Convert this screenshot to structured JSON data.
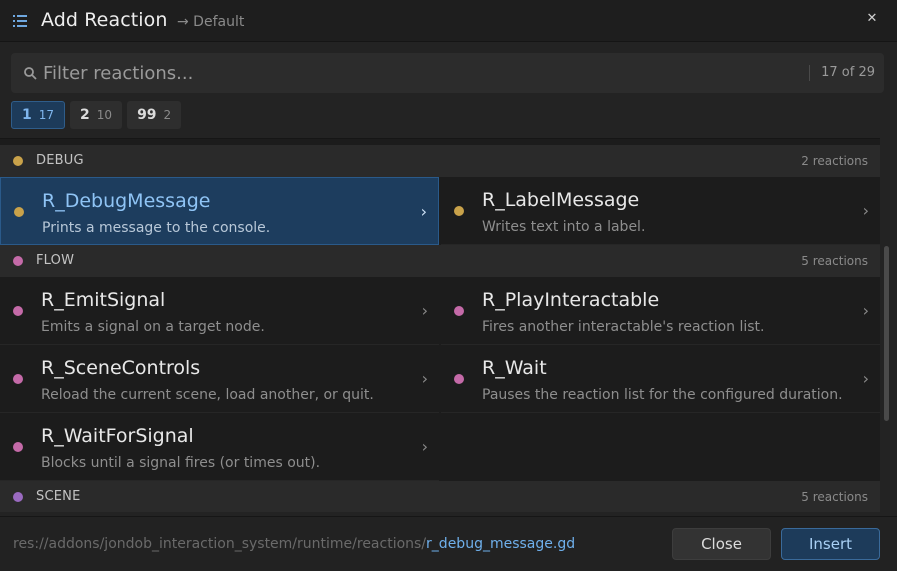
{
  "window": {
    "title": "Add Reaction",
    "subtitle": "→ Default",
    "close_label": "✕"
  },
  "search": {
    "placeholder": "Filter reactions...",
    "value": "",
    "count": "17 of 29"
  },
  "chips": [
    {
      "level": "1",
      "count": "17",
      "active": true
    },
    {
      "level": "2",
      "count": "10",
      "active": false
    },
    {
      "level": "99",
      "count": "2",
      "active": false
    }
  ],
  "sections": [
    {
      "name": "DEBUG",
      "count": "2 reactions",
      "color": "#c9a24a"
    },
    {
      "name": "FLOW",
      "count": "5 reactions",
      "color": "#c46aa8"
    },
    {
      "name": "SCENE",
      "count": "5 reactions",
      "color": "#9a6ac0"
    }
  ],
  "items": [
    {
      "name": "R_DebugMessage",
      "desc": "Prints a message to the console.",
      "color": "#c9a24a",
      "selected": true
    },
    {
      "name": "R_LabelMessage",
      "desc": "Writes text into a label.",
      "color": "#c9a24a",
      "selected": false
    },
    {
      "name": "R_EmitSignal",
      "desc": "Emits a signal on a target node.",
      "color": "#c46aa8",
      "selected": false
    },
    {
      "name": "R_PlayInteractable",
      "desc": "Fires another interactable's reaction list.",
      "color": "#c46aa8",
      "selected": false
    },
    {
      "name": "R_SceneControls",
      "desc": "Reload the current scene, load another, or quit.",
      "color": "#c46aa8",
      "selected": false
    },
    {
      "name": "R_Wait",
      "desc": "Pauses the reaction list for the configured duration.",
      "color": "#c46aa8",
      "selected": false
    },
    {
      "name": "R_WaitForSignal",
      "desc": "Blocks until a signal fires (or times out).",
      "color": "#c46aa8",
      "selected": false
    }
  ],
  "footer": {
    "path_prefix": "res://addons/jondob_interaction_system/runtime/reactions/",
    "path_file": "r_debug_message.gd",
    "close_label": "Close",
    "insert_label": "Insert"
  },
  "chevron": "›",
  "icons": {
    "title": "list-icon",
    "search": "search-icon"
  }
}
